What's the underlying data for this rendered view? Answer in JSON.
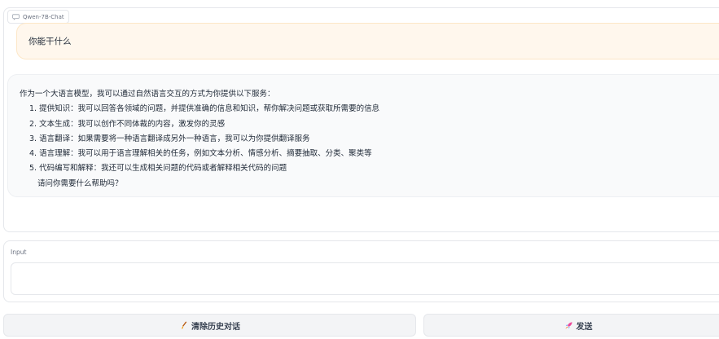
{
  "chatbot": {
    "label": "Qwen-7B-Chat",
    "messages": [
      {
        "role": "user",
        "text": "你能干什么"
      },
      {
        "role": "assistant",
        "lines": [
          "作为一个大语言模型，我可以通过自然语言交互的方式为你提供以下服务：",
          "1. 提供知识：我可以回答各领域的问题，并提供准确的信息和知识，帮你解决问题或获取所需要的信息",
          "2. 文本生成：我可以创作不同体裁的内容，激发你的灵感",
          "3. 语言翻译：如果需要将一种语言翻译成另外一种语言，我可以为你提供翻译服务",
          "4. 语言理解：我可以用于语言理解相关的任务，例如文本分析、情感分析、摘要抽取、分类、聚类等",
          "5. 代码编写和解释：我还可以生成相关问题的代码或者解释相关代码的问题",
          "请问你需要什么帮助吗？"
        ]
      }
    ]
  },
  "input": {
    "label": "Input",
    "value": "",
    "placeholder": ""
  },
  "buttons": {
    "clear": {
      "icon": "broom-icon",
      "label": "清除历史对话"
    },
    "send": {
      "icon": "rocket-icon",
      "label": "发送"
    }
  }
}
